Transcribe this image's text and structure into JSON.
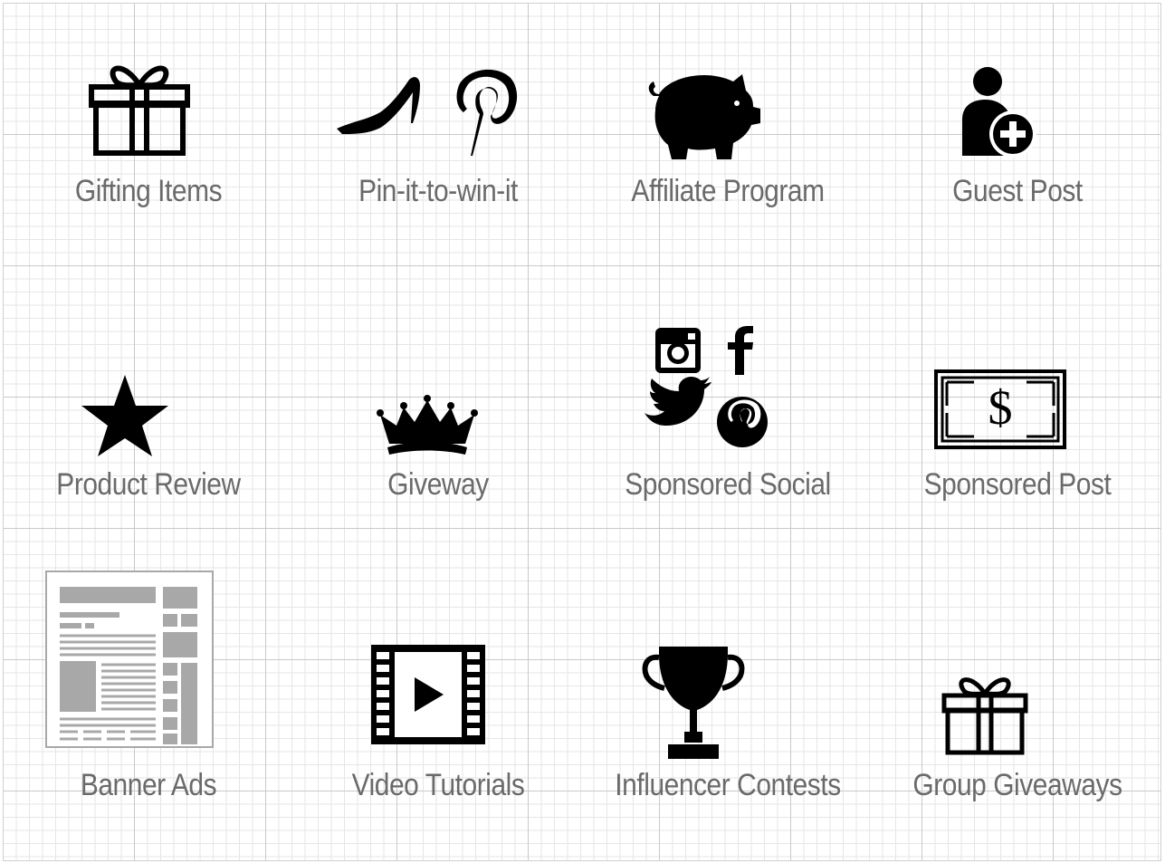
{
  "items": [
    {
      "label": "Gifting Items",
      "icon": "gift-icon"
    },
    {
      "label": "Pin-it-to-win-it",
      "icon": "high-heel-pinterest-icon"
    },
    {
      "label": "Affiliate Program",
      "icon": "piggy-bank-icon"
    },
    {
      "label": "Guest Post",
      "icon": "add-user-icon"
    },
    {
      "label": "Product Review",
      "icon": "star-icon"
    },
    {
      "label": "Giveway",
      "icon": "crown-icon"
    },
    {
      "label": "Sponsored Social",
      "icon": "social-media-icons"
    },
    {
      "label": "Sponsored Post",
      "icon": "dollar-bill-icon"
    },
    {
      "label": "Banner Ads",
      "icon": "webpage-layout-icon"
    },
    {
      "label": "Video Tutorials",
      "icon": "film-play-icon"
    },
    {
      "label": "Influencer Contests",
      "icon": "trophy-icon"
    },
    {
      "label": "Group Giveaways",
      "icon": "gift-icon"
    }
  ],
  "colors": {
    "icon": "#000000",
    "label": "#6a6a6a",
    "grid": "#e6e6e6",
    "banner_gray": "#a8a8a8"
  }
}
